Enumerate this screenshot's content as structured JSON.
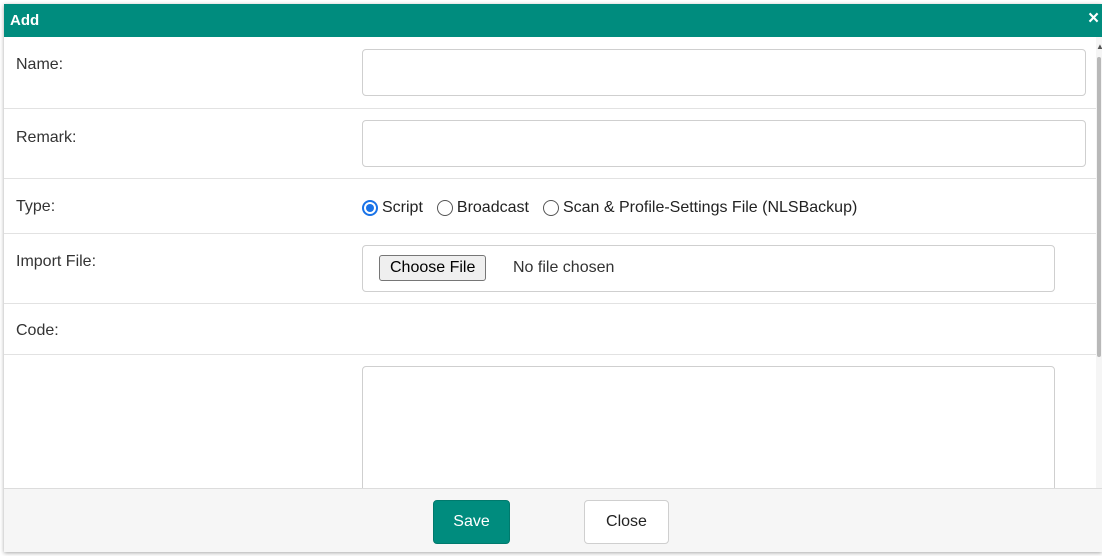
{
  "dialog": {
    "title": "Add",
    "close_icon": "×"
  },
  "form": {
    "name": {
      "label": "Name:",
      "value": ""
    },
    "remark": {
      "label": "Remark:",
      "value": ""
    },
    "type": {
      "label": "Type:",
      "options": [
        "Script",
        "Broadcast",
        "Scan & Profile-Settings File (NLSBackup)"
      ],
      "selected": "Script"
    },
    "import_file": {
      "label": "Import File:",
      "button_label": "Choose File",
      "status": "No file chosen"
    },
    "code": {
      "label": "Code:",
      "value": ""
    }
  },
  "footer": {
    "save_label": "Save",
    "close_label": "Close"
  },
  "colors": {
    "primary": "#008c7e",
    "radio_accent": "#1a73e8"
  }
}
